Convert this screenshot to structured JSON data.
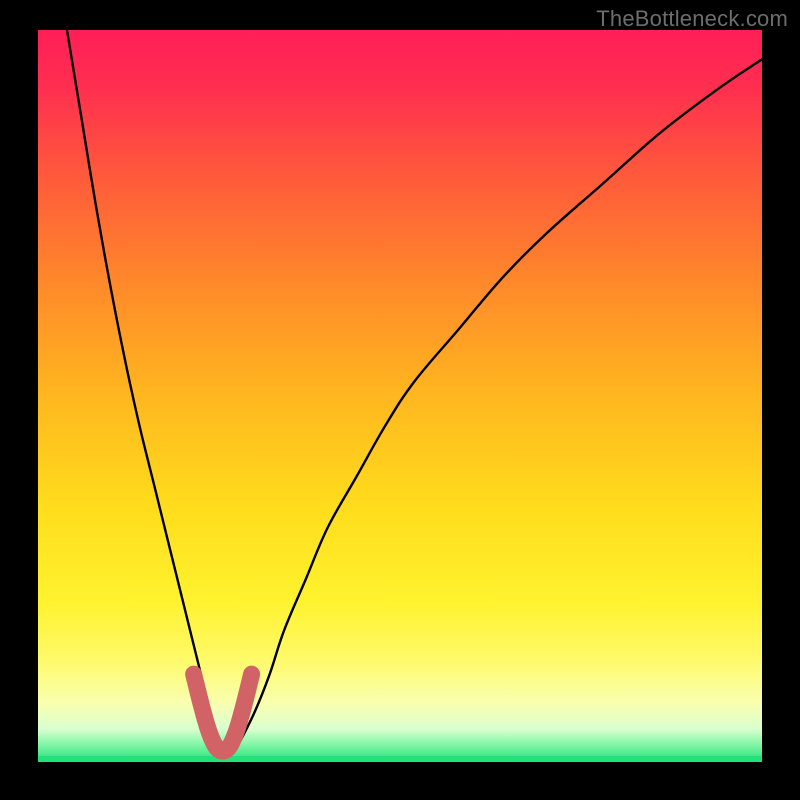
{
  "watermark": {
    "text": "TheBottleneck.com"
  },
  "colors": {
    "frame": "#000000",
    "curve": "#000000",
    "accent": "#d16366",
    "greenBar": "#22e07a",
    "gradient_stops": [
      {
        "offset": 0.0,
        "color": "#ff1f57"
      },
      {
        "offset": 0.08,
        "color": "#ff2f4f"
      },
      {
        "offset": 0.2,
        "color": "#ff5a3b"
      },
      {
        "offset": 0.35,
        "color": "#ff8a2a"
      },
      {
        "offset": 0.5,
        "color": "#ffb71f"
      },
      {
        "offset": 0.65,
        "color": "#ffdc1c"
      },
      {
        "offset": 0.78,
        "color": "#fff22e"
      },
      {
        "offset": 0.86,
        "color": "#fffa6a"
      },
      {
        "offset": 0.92,
        "color": "#f9ffb0"
      },
      {
        "offset": 0.955,
        "color": "#d9ffcf"
      },
      {
        "offset": 0.975,
        "color": "#87f7a8"
      },
      {
        "offset": 1.0,
        "color": "#22e07a"
      }
    ]
  },
  "chart_data": {
    "type": "line",
    "title": "",
    "xlabel": "",
    "ylabel": "",
    "xlim": [
      0,
      100
    ],
    "ylim": [
      0,
      100
    ],
    "grid": false,
    "legend": false,
    "series": [
      {
        "name": "bottleneck-curve",
        "x": [
          4,
          6,
          8,
          10,
          12,
          14,
          16,
          18,
          20,
          22,
          23,
          24,
          25,
          26,
          27,
          28,
          30,
          32,
          34,
          37,
          40,
          44,
          48,
          52,
          58,
          64,
          70,
          78,
          86,
          94,
          100
        ],
        "y": [
          100,
          88,
          76,
          65,
          55,
          46,
          38,
          30,
          22,
          14,
          10,
          6,
          3,
          1.5,
          1.5,
          3,
          7,
          12,
          18,
          25,
          32,
          39,
          46,
          52,
          59,
          66,
          72,
          79,
          86,
          92,
          96
        ]
      }
    ],
    "accent_segment": {
      "name": "valley-highlight",
      "x": [
        21.5,
        22.5,
        23.5,
        24.5,
        25.5,
        26.5,
        27.5,
        28.5,
        29.5
      ],
      "y": [
        12,
        8,
        4.5,
        2.2,
        1.5,
        2.2,
        4.5,
        8,
        12
      ]
    }
  }
}
